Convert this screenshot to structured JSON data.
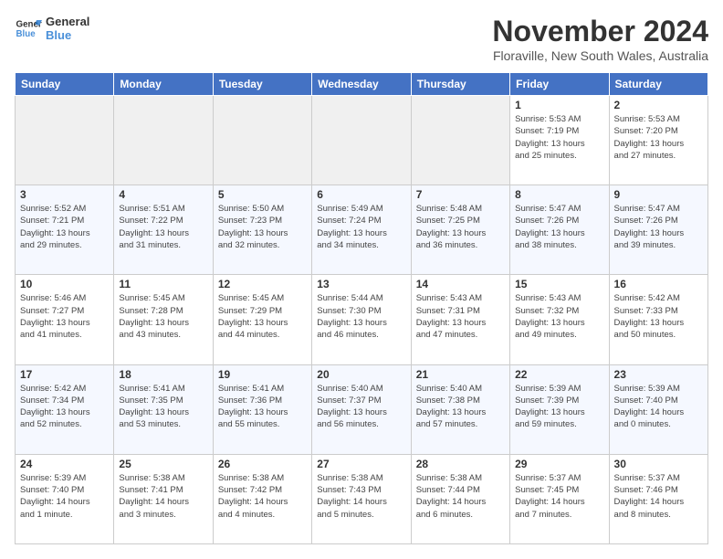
{
  "header": {
    "logo_general": "General",
    "logo_blue": "Blue",
    "month_title": "November 2024",
    "location": "Floraville, New South Wales, Australia"
  },
  "weekdays": [
    "Sunday",
    "Monday",
    "Tuesday",
    "Wednesday",
    "Thursday",
    "Friday",
    "Saturday"
  ],
  "weeks": [
    [
      {
        "day": "",
        "info": ""
      },
      {
        "day": "",
        "info": ""
      },
      {
        "day": "",
        "info": ""
      },
      {
        "day": "",
        "info": ""
      },
      {
        "day": "",
        "info": ""
      },
      {
        "day": "1",
        "info": "Sunrise: 5:53 AM\nSunset: 7:19 PM\nDaylight: 13 hours\nand 25 minutes."
      },
      {
        "day": "2",
        "info": "Sunrise: 5:53 AM\nSunset: 7:20 PM\nDaylight: 13 hours\nand 27 minutes."
      }
    ],
    [
      {
        "day": "3",
        "info": "Sunrise: 5:52 AM\nSunset: 7:21 PM\nDaylight: 13 hours\nand 29 minutes."
      },
      {
        "day": "4",
        "info": "Sunrise: 5:51 AM\nSunset: 7:22 PM\nDaylight: 13 hours\nand 31 minutes."
      },
      {
        "day": "5",
        "info": "Sunrise: 5:50 AM\nSunset: 7:23 PM\nDaylight: 13 hours\nand 32 minutes."
      },
      {
        "day": "6",
        "info": "Sunrise: 5:49 AM\nSunset: 7:24 PM\nDaylight: 13 hours\nand 34 minutes."
      },
      {
        "day": "7",
        "info": "Sunrise: 5:48 AM\nSunset: 7:25 PM\nDaylight: 13 hours\nand 36 minutes."
      },
      {
        "day": "8",
        "info": "Sunrise: 5:47 AM\nSunset: 7:26 PM\nDaylight: 13 hours\nand 38 minutes."
      },
      {
        "day": "9",
        "info": "Sunrise: 5:47 AM\nSunset: 7:26 PM\nDaylight: 13 hours\nand 39 minutes."
      }
    ],
    [
      {
        "day": "10",
        "info": "Sunrise: 5:46 AM\nSunset: 7:27 PM\nDaylight: 13 hours\nand 41 minutes."
      },
      {
        "day": "11",
        "info": "Sunrise: 5:45 AM\nSunset: 7:28 PM\nDaylight: 13 hours\nand 43 minutes."
      },
      {
        "day": "12",
        "info": "Sunrise: 5:45 AM\nSunset: 7:29 PM\nDaylight: 13 hours\nand 44 minutes."
      },
      {
        "day": "13",
        "info": "Sunrise: 5:44 AM\nSunset: 7:30 PM\nDaylight: 13 hours\nand 46 minutes."
      },
      {
        "day": "14",
        "info": "Sunrise: 5:43 AM\nSunset: 7:31 PM\nDaylight: 13 hours\nand 47 minutes."
      },
      {
        "day": "15",
        "info": "Sunrise: 5:43 AM\nSunset: 7:32 PM\nDaylight: 13 hours\nand 49 minutes."
      },
      {
        "day": "16",
        "info": "Sunrise: 5:42 AM\nSunset: 7:33 PM\nDaylight: 13 hours\nand 50 minutes."
      }
    ],
    [
      {
        "day": "17",
        "info": "Sunrise: 5:42 AM\nSunset: 7:34 PM\nDaylight: 13 hours\nand 52 minutes."
      },
      {
        "day": "18",
        "info": "Sunrise: 5:41 AM\nSunset: 7:35 PM\nDaylight: 13 hours\nand 53 minutes."
      },
      {
        "day": "19",
        "info": "Sunrise: 5:41 AM\nSunset: 7:36 PM\nDaylight: 13 hours\nand 55 minutes."
      },
      {
        "day": "20",
        "info": "Sunrise: 5:40 AM\nSunset: 7:37 PM\nDaylight: 13 hours\nand 56 minutes."
      },
      {
        "day": "21",
        "info": "Sunrise: 5:40 AM\nSunset: 7:38 PM\nDaylight: 13 hours\nand 57 minutes."
      },
      {
        "day": "22",
        "info": "Sunrise: 5:39 AM\nSunset: 7:39 PM\nDaylight: 13 hours\nand 59 minutes."
      },
      {
        "day": "23",
        "info": "Sunrise: 5:39 AM\nSunset: 7:40 PM\nDaylight: 14 hours\nand 0 minutes."
      }
    ],
    [
      {
        "day": "24",
        "info": "Sunrise: 5:39 AM\nSunset: 7:40 PM\nDaylight: 14 hours\nand 1 minute."
      },
      {
        "day": "25",
        "info": "Sunrise: 5:38 AM\nSunset: 7:41 PM\nDaylight: 14 hours\nand 3 minutes."
      },
      {
        "day": "26",
        "info": "Sunrise: 5:38 AM\nSunset: 7:42 PM\nDaylight: 14 hours\nand 4 minutes."
      },
      {
        "day": "27",
        "info": "Sunrise: 5:38 AM\nSunset: 7:43 PM\nDaylight: 14 hours\nand 5 minutes."
      },
      {
        "day": "28",
        "info": "Sunrise: 5:38 AM\nSunset: 7:44 PM\nDaylight: 14 hours\nand 6 minutes."
      },
      {
        "day": "29",
        "info": "Sunrise: 5:37 AM\nSunset: 7:45 PM\nDaylight: 14 hours\nand 7 minutes."
      },
      {
        "day": "30",
        "info": "Sunrise: 5:37 AM\nSunset: 7:46 PM\nDaylight: 14 hours\nand 8 minutes."
      }
    ]
  ]
}
